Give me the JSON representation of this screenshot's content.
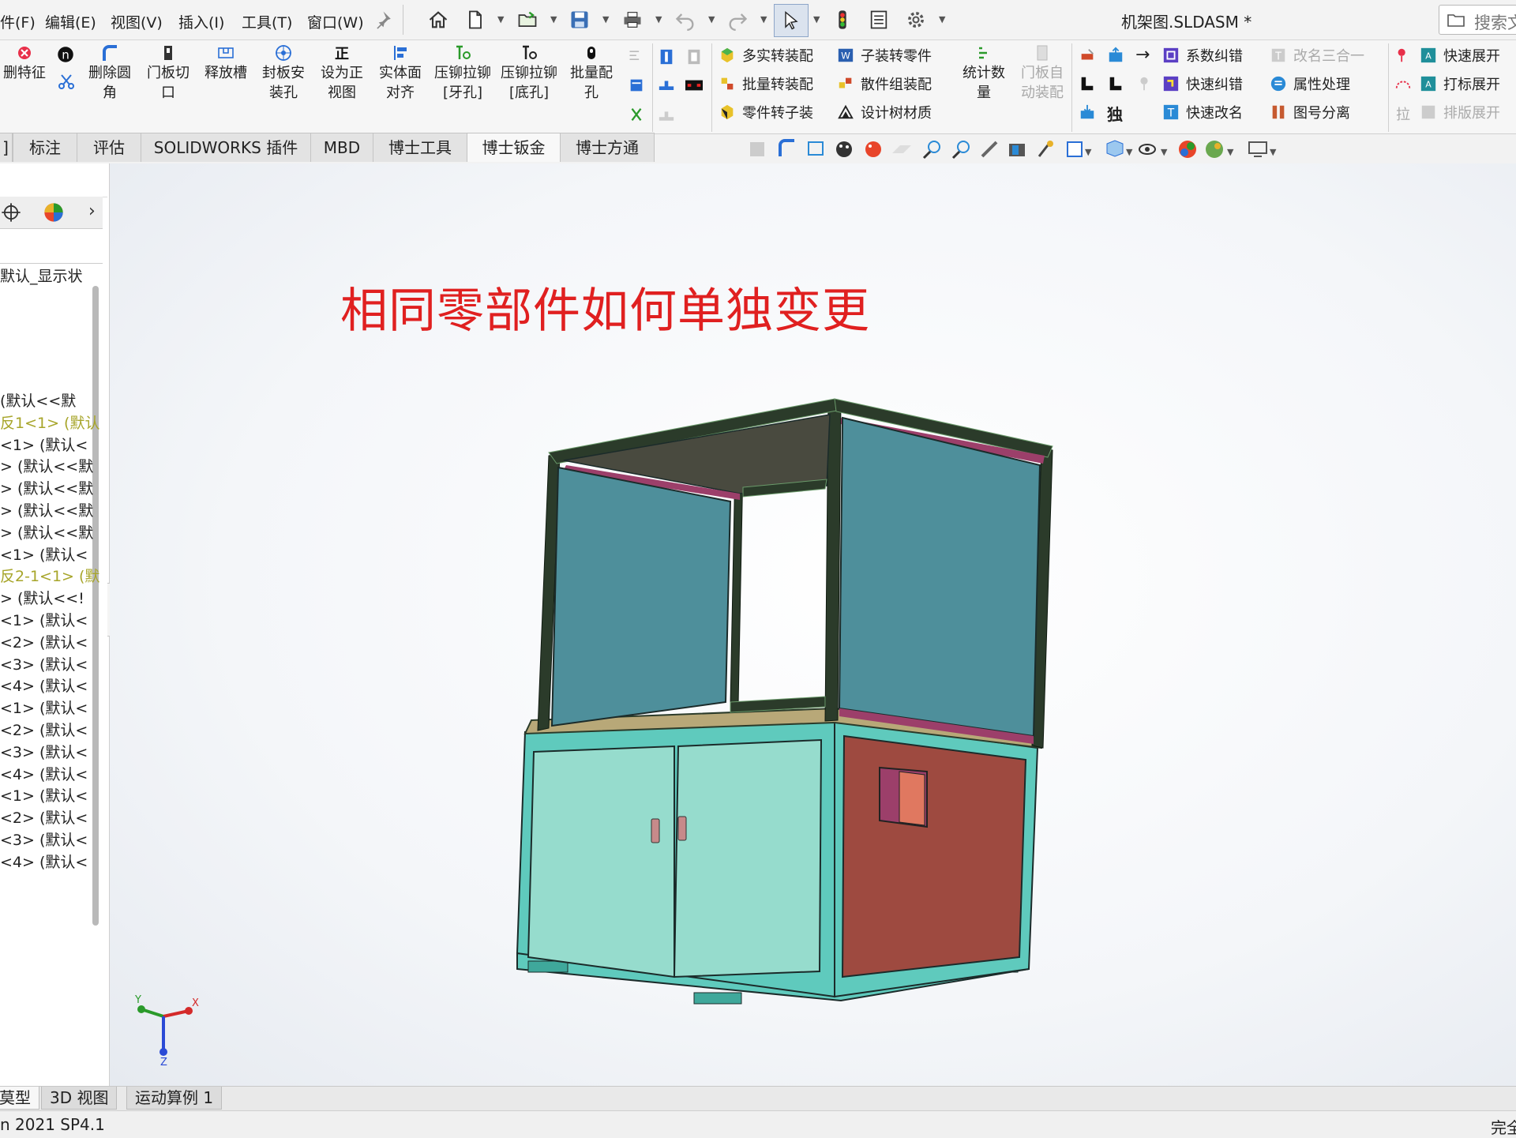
{
  "menubar": {
    "items": [
      "件(F)",
      "编辑(E)",
      "视图(V)",
      "插入(I)",
      "工具(T)",
      "窗口(W)"
    ],
    "document_title": "机架图.SLDASM *",
    "search_placeholder": "搜索文"
  },
  "command_manager": {
    "big_buttons": [
      {
        "label": "删特征",
        "icon": "delete-feature-icon"
      },
      {
        "label": "删除圆角",
        "icon": "delete-fillet-icon"
      },
      {
        "label": "门板切口",
        "icon": "door-cut-icon"
      },
      {
        "label": "释放槽",
        "icon": "relief-slot-icon"
      },
      {
        "label": "封板安装孔",
        "icon": "mount-hole-icon"
      },
      {
        "label": "设为正视图",
        "icon": "normal-view-icon"
      },
      {
        "label": "实体面对齐",
        "icon": "face-align-icon"
      },
      {
        "label": "压铆拉铆[牙孔]",
        "icon": "rivet-thread-icon"
      },
      {
        "label": "压铆拉铆[底孔]",
        "icon": "rivet-hole-icon"
      },
      {
        "label": "批量配孔",
        "icon": "batch-hole-icon"
      }
    ],
    "group1": [
      "多实转装配",
      "批量转装配",
      "零件转子装"
    ],
    "group2": [
      "子装转零件",
      "散件组装配",
      "设计树材质"
    ],
    "stat_button": "统计数量",
    "door_auto": "门板自动装配",
    "group3": [
      "→",
      "独"
    ],
    "group4": [
      "系数纠错",
      "快速纠错",
      "快速改名"
    ],
    "group5": [
      "改名三合一",
      "属性处理",
      "图号分离"
    ],
    "group6": [
      "快速展开",
      "打标展开",
      "排版展开"
    ],
    "group6_left": [
      "拉"
    ]
  },
  "tabs": [
    {
      "label": "]",
      "active": false
    },
    {
      "label": "标注",
      "active": false
    },
    {
      "label": "评估",
      "active": false
    },
    {
      "label": "SOLIDWORKS 插件",
      "active": false
    },
    {
      "label": "MBD",
      "active": false
    },
    {
      "label": "博士工具",
      "active": false
    },
    {
      "label": "博士钣金",
      "active": true
    },
    {
      "label": "博士方通",
      "active": false
    }
  ],
  "tree": {
    "display_state": "默认_显示状",
    "rows": [
      {
        "text": "(默认<<默",
        "olive": false
      },
      {
        "text": "反1<1> (默认",
        "olive": true
      },
      {
        "text": "<1> (默认<",
        "olive": false
      },
      {
        "text": "> (默认<<默",
        "olive": false
      },
      {
        "text": "> (默认<<默",
        "olive": false
      },
      {
        "text": "> (默认<<默",
        "olive": false
      },
      {
        "text": "> (默认<<默",
        "olive": false
      },
      {
        "text": "<1> (默认<",
        "olive": false
      },
      {
        "text": "反2-1<1> (默",
        "olive": true
      },
      {
        "text": "> (默认<<!",
        "olive": false
      },
      {
        "text": "<1> (默认<",
        "olive": false
      },
      {
        "text": "<2> (默认<",
        "olive": false
      },
      {
        "text": "<3> (默认<",
        "olive": false
      },
      {
        "text": "<4> (默认<",
        "olive": false
      },
      {
        "text": "<1> (默认<",
        "olive": false
      },
      {
        "text": "<2> (默认<",
        "olive": false
      },
      {
        "text": "<3> (默认<",
        "olive": false
      },
      {
        "text": "<4> (默认<",
        "olive": false
      },
      {
        "text": "<1> (默认<",
        "olive": false
      },
      {
        "text": "<2> (默认<",
        "olive": false
      },
      {
        "text": "<3> (默认<",
        "olive": false
      },
      {
        "text": "<4> (默认<",
        "olive": false
      }
    ]
  },
  "viewport": {
    "overlay_title": "相同零部件如何单独变更",
    "axis_labels": {
      "x": "X",
      "y": "Y",
      "z": "Z"
    }
  },
  "bottom_tabs": [
    {
      "label": "莫型",
      "active": true
    },
    {
      "label": "3D 视图",
      "active": false
    },
    {
      "label": "运动算例 1",
      "active": false
    }
  ],
  "status": {
    "version": "n 2021 SP4.1",
    "right": "完全"
  },
  "colors": {
    "accent_blue": "#2a6fd6",
    "title_red": "#e02020",
    "panel_teal": "#4e8f9b",
    "cabinet_door": "#96dccd",
    "side_panel": "#9e4a40",
    "frame_green": "#2b3b2a",
    "frame_cyan": "#5fcabd"
  }
}
